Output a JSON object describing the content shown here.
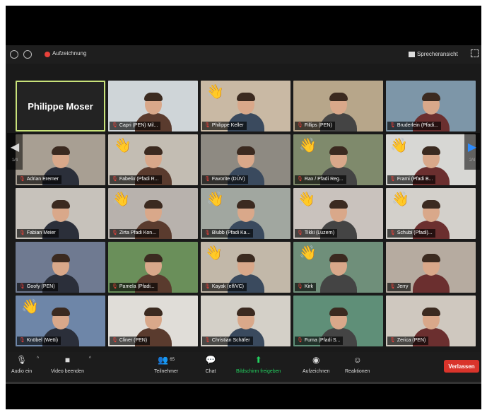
{
  "topbar": {
    "recording_label": "Aufzeichnung",
    "view_label": "Sprecheransicht"
  },
  "gallery": {
    "page_indicator_left": "1/4",
    "page_indicator_right": "2/4",
    "tiles": [
      {
        "name": "Philippe Moser",
        "type": "name-only",
        "bg": "#232323"
      },
      {
        "name": "Capri (PEN) Mil...",
        "bg": "#cfd5d8",
        "wave": false
      },
      {
        "name": "Philippe Keller",
        "bg": "#c9b9a4",
        "wave": true
      },
      {
        "name": "Fillips (PEN)",
        "bg": "#b7a68a",
        "wave": false
      },
      {
        "name": "Bruderlein (Pfadi...",
        "bg": "#7d96a8",
        "wave": false
      },
      {
        "name": "Adrian Eremer",
        "bg": "#a89f93",
        "wave": false
      },
      {
        "name": "Fabelix (Pfadi R...",
        "bg": "#c3bdb3",
        "wave": true
      },
      {
        "name": "Favorite (DÜV)",
        "bg": "#8e8a82",
        "wave": false
      },
      {
        "name": "Rax / Pfadi Reg...",
        "bg": "#7f8a6c",
        "wave": true
      },
      {
        "name": "Frami (Pfadi B...",
        "bg": "#d7d7d4",
        "wave": true
      },
      {
        "name": "Fabian Meier",
        "bg": "#c7c2bb",
        "wave": false
      },
      {
        "name": "Zirta Pfadi Kon...",
        "bg": "#b8b2ad",
        "wave": true
      },
      {
        "name": "Blubb (Pfadi Ka...",
        "bg": "#a1a7a0",
        "wave": true
      },
      {
        "name": "Tikki (Luzern)",
        "bg": "#c9c2bd",
        "wave": true
      },
      {
        "name": "Schubi (Pfadi)...",
        "bg": "#d3d0cb",
        "wave": true
      },
      {
        "name": "Goofy (PEN)",
        "bg": "#6f7a91",
        "wave": false
      },
      {
        "name": "Pamela (Pfadi...",
        "bg": "#6a8f5a",
        "wave": false
      },
      {
        "name": "Kayak (elf/VC)",
        "bg": "#c2b8a9",
        "wave": true
      },
      {
        "name": "Kirk",
        "bg": "#6f8f7a",
        "wave": true
      },
      {
        "name": "Jerry",
        "bg": "#b6aba0",
        "wave": false
      },
      {
        "name": "Knöbel (Wetti)",
        "bg": "#6e86a8",
        "wave": true
      },
      {
        "name": "Cliner (PEN)",
        "bg": "#e0ddd8",
        "wave": false
      },
      {
        "name": "Christian Schäfer",
        "bg": "#d4d0c8",
        "wave": false
      },
      {
        "name": "Fuma (Pfadi S...",
        "bg": "#5f8f78",
        "wave": false
      },
      {
        "name": "Zerica (PEN)",
        "bg": "#cfc8bf",
        "wave": false
      }
    ]
  },
  "toolbar": {
    "audio_label": "Audio ein",
    "video_label": "Video beenden",
    "participants_label": "Teilnehmer",
    "participants_count": "65",
    "chat_label": "Chat",
    "share_label": "Bildschirm freigeben",
    "record_label": "Aufzeichnen",
    "reactions_label": "Reaktionen",
    "leave_label": "Verlassen"
  },
  "colors": {
    "active_speaker_border": "#c8e27a",
    "share_green": "#23d160",
    "leave_red": "#d9342b",
    "record_red": "#e8413a"
  }
}
